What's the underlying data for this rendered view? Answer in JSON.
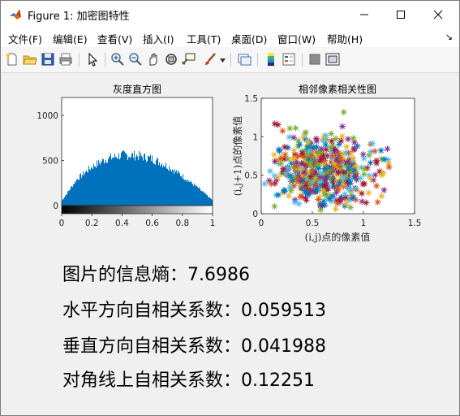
{
  "window": {
    "title": "Figure 1: 加密图特性",
    "controls": [
      "minimize",
      "maximize",
      "close"
    ]
  },
  "menubar": {
    "items": [
      "文件(F)",
      "编辑(E)",
      "查看(V)",
      "插入(I)",
      "工具(T)",
      "桌面(D)",
      "窗口(W)",
      "帮助(H)"
    ]
  },
  "toolbar": {
    "icons": [
      "new-figure-icon",
      "open-icon",
      "save-icon",
      "print-icon",
      "pointer-icon",
      "zoom-in-icon",
      "zoom-out-icon",
      "pan-icon",
      "rotate-3d-icon",
      "data-cursor-icon",
      "brush-icon",
      "brush-dropdown-icon",
      "link-plot-icon",
      "colorbar-icon",
      "legend-icon",
      "hide-plot-tools-icon",
      "show-plot-tools-icon"
    ]
  },
  "chart_data": [
    {
      "type": "bar",
      "title": "灰度直方图",
      "xlabel": "",
      "ylabel": "",
      "xlim": [
        0,
        1
      ],
      "ylim": [
        0,
        1200
      ],
      "xticks": [
        "0",
        "0.2",
        "0.4",
        "0.6",
        "0.8",
        "1"
      ],
      "yticks": [
        "0",
        "500",
        "1000"
      ],
      "description_of_shape": "dense histogram, roughly parabolic envelope",
      "envelope": [
        [
          0,
          50
        ],
        [
          0.1,
          290
        ],
        [
          0.2,
          430
        ],
        [
          0.3,
          520
        ],
        [
          0.4,
          560
        ],
        [
          0.5,
          555
        ],
        [
          0.6,
          520
        ],
        [
          0.7,
          440
        ],
        [
          0.8,
          330
        ],
        [
          0.9,
          200
        ],
        [
          1.0,
          60
        ]
      ],
      "bar_color": "#0072bd",
      "colorbar": "grayscale 0 to 1"
    },
    {
      "type": "scatter",
      "title": "相邻像素相关性图",
      "xlabel": "(i,j)点的像素值",
      "ylabel": "(i,j+1)点的像素值",
      "xlim": [
        0,
        1.5
      ],
      "ylim": [
        0,
        1.5
      ],
      "xticks": [
        "0",
        "0.5",
        "1",
        "1.5"
      ],
      "yticks": [
        "0",
        "0.5",
        "1",
        "1.5"
      ],
      "marker": "*",
      "series_colors": [
        "#0072bd",
        "#d95319",
        "#edb120",
        "#7e2f8e",
        "#77ac30",
        "#4dbeee",
        "#a2142f"
      ],
      "point_cloud": "dense scattered points spanning x 0–1.5 and y 0–1.4, densest around x 0.2–1.0, y 0.2–1.0"
    }
  ],
  "results": {
    "entropy": "图片的信息熵：7.6986",
    "horizontal": "水平方向自相关系数：0.059513",
    "vertical": "垂直方向自相关系数：0.041988",
    "diagonal": "对角线上自相关系数：0.12251"
  }
}
